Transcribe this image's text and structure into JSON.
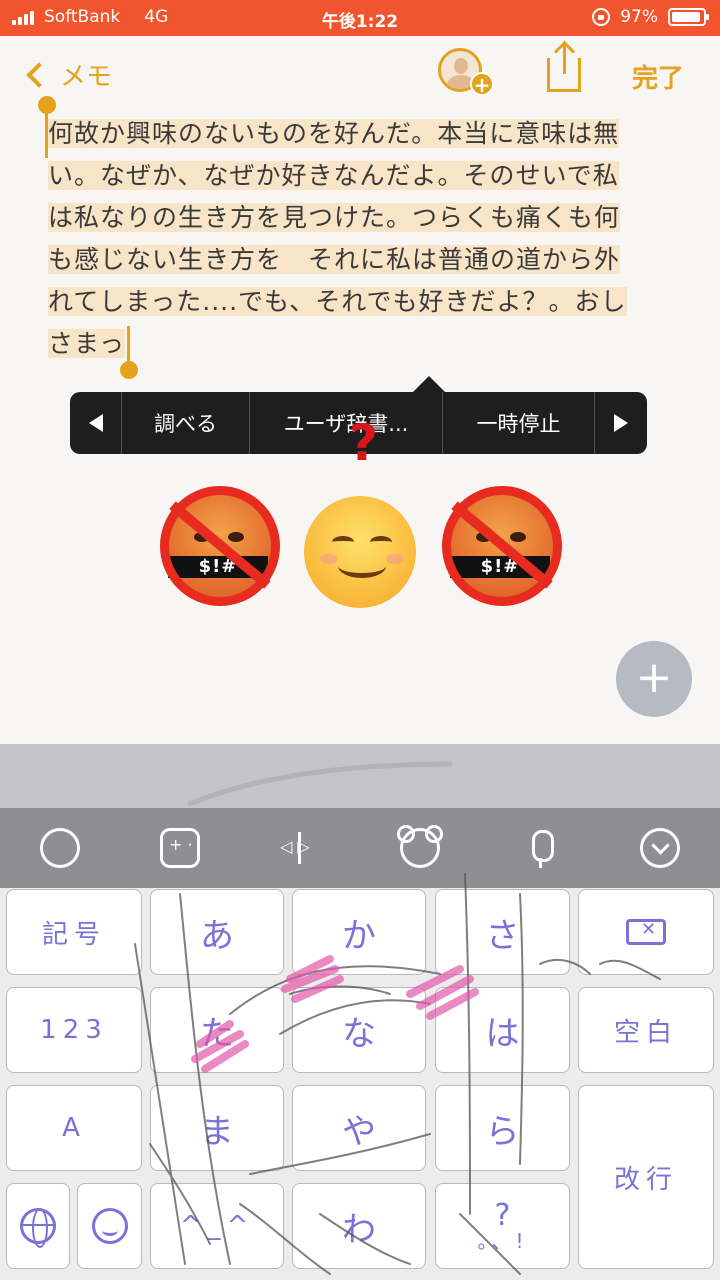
{
  "status_bar": {
    "carrier": "SoftBank",
    "network": "4G",
    "time": "午後1:22",
    "battery": "97%"
  },
  "nav": {
    "back_label": "メモ",
    "done_label": "完了"
  },
  "note": {
    "lines": [
      "何故か興味のないものを好んだ。本当に意味は無",
      "い。なぜか、なぜか好きなんだよ。そのせいで私",
      "は私なりの生き方を見つけた。つらくも痛くも何",
      "も感じない生き方を　それに私は普通の道から外",
      "れてしまった....でも、それでも好きだよ？。おし",
      "さまっ"
    ]
  },
  "edit_menu": {
    "items": [
      "調べる",
      "ユーザ辞書...",
      "一時停止"
    ]
  },
  "overlay": {
    "question_mark": "?",
    "censor_text": "$!#"
  },
  "keyboard": {
    "rows": [
      [
        "記号",
        "あ",
        "か",
        "さ"
      ],
      [
        "123",
        "た",
        "な",
        "は",
        "空白"
      ],
      [
        "A",
        "ま",
        "や",
        "ら",
        "改行"
      ],
      [
        "^_^",
        "わ",
        "?",
        "。、!"
      ]
    ]
  },
  "icons": {
    "toolbar": [
      "speech-bubble-icon",
      "game-controller-icon",
      "text-cursor-icon",
      "bear-face-icon",
      "microphone-icon",
      "chevron-down-circle-icon"
    ],
    "keys": [
      "globe-icon",
      "emoji-icon",
      "delete-icon"
    ]
  },
  "colors": {
    "status_bar": "#f2542d",
    "accent": "#e5a21d",
    "selection": "#f8e4c7",
    "key_text": "#7a72d9",
    "fab": "#b5bac3"
  }
}
